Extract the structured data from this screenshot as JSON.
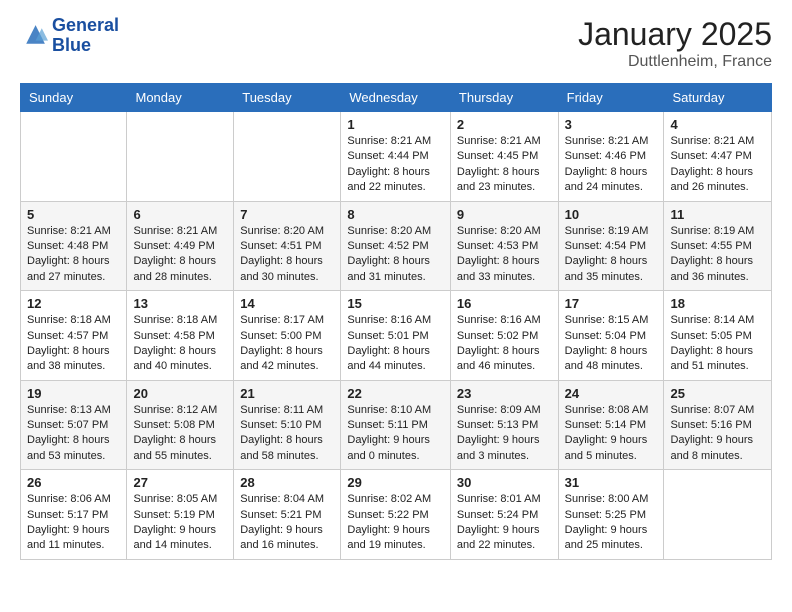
{
  "logo": {
    "line1": "General",
    "line2": "Blue"
  },
  "title": "January 2025",
  "location": "Duttlenheim, France",
  "weekdays": [
    "Sunday",
    "Monday",
    "Tuesday",
    "Wednesday",
    "Thursday",
    "Friday",
    "Saturday"
  ],
  "weeks": [
    [
      {
        "day": null
      },
      {
        "day": null
      },
      {
        "day": null
      },
      {
        "day": "1",
        "sunrise": "8:21 AM",
        "sunset": "4:44 PM",
        "daylight": "8 hours and 22 minutes."
      },
      {
        "day": "2",
        "sunrise": "8:21 AM",
        "sunset": "4:45 PM",
        "daylight": "8 hours and 23 minutes."
      },
      {
        "day": "3",
        "sunrise": "8:21 AM",
        "sunset": "4:46 PM",
        "daylight": "8 hours and 24 minutes."
      },
      {
        "day": "4",
        "sunrise": "8:21 AM",
        "sunset": "4:47 PM",
        "daylight": "8 hours and 26 minutes."
      }
    ],
    [
      {
        "day": "5",
        "sunrise": "8:21 AM",
        "sunset": "4:48 PM",
        "daylight": "8 hours and 27 minutes."
      },
      {
        "day": "6",
        "sunrise": "8:21 AM",
        "sunset": "4:49 PM",
        "daylight": "8 hours and 28 minutes."
      },
      {
        "day": "7",
        "sunrise": "8:20 AM",
        "sunset": "4:51 PM",
        "daylight": "8 hours and 30 minutes."
      },
      {
        "day": "8",
        "sunrise": "8:20 AM",
        "sunset": "4:52 PM",
        "daylight": "8 hours and 31 minutes."
      },
      {
        "day": "9",
        "sunrise": "8:20 AM",
        "sunset": "4:53 PM",
        "daylight": "8 hours and 33 minutes."
      },
      {
        "day": "10",
        "sunrise": "8:19 AM",
        "sunset": "4:54 PM",
        "daylight": "8 hours and 35 minutes."
      },
      {
        "day": "11",
        "sunrise": "8:19 AM",
        "sunset": "4:55 PM",
        "daylight": "8 hours and 36 minutes."
      }
    ],
    [
      {
        "day": "12",
        "sunrise": "8:18 AM",
        "sunset": "4:57 PM",
        "daylight": "8 hours and 38 minutes."
      },
      {
        "day": "13",
        "sunrise": "8:18 AM",
        "sunset": "4:58 PM",
        "daylight": "8 hours and 40 minutes."
      },
      {
        "day": "14",
        "sunrise": "8:17 AM",
        "sunset": "5:00 PM",
        "daylight": "8 hours and 42 minutes."
      },
      {
        "day": "15",
        "sunrise": "8:16 AM",
        "sunset": "5:01 PM",
        "daylight": "8 hours and 44 minutes."
      },
      {
        "day": "16",
        "sunrise": "8:16 AM",
        "sunset": "5:02 PM",
        "daylight": "8 hours and 46 minutes."
      },
      {
        "day": "17",
        "sunrise": "8:15 AM",
        "sunset": "5:04 PM",
        "daylight": "8 hours and 48 minutes."
      },
      {
        "day": "18",
        "sunrise": "8:14 AM",
        "sunset": "5:05 PM",
        "daylight": "8 hours and 51 minutes."
      }
    ],
    [
      {
        "day": "19",
        "sunrise": "8:13 AM",
        "sunset": "5:07 PM",
        "daylight": "8 hours and 53 minutes."
      },
      {
        "day": "20",
        "sunrise": "8:12 AM",
        "sunset": "5:08 PM",
        "daylight": "8 hours and 55 minutes."
      },
      {
        "day": "21",
        "sunrise": "8:11 AM",
        "sunset": "5:10 PM",
        "daylight": "8 hours and 58 minutes."
      },
      {
        "day": "22",
        "sunrise": "8:10 AM",
        "sunset": "5:11 PM",
        "daylight": "9 hours and 0 minutes."
      },
      {
        "day": "23",
        "sunrise": "8:09 AM",
        "sunset": "5:13 PM",
        "daylight": "9 hours and 3 minutes."
      },
      {
        "day": "24",
        "sunrise": "8:08 AM",
        "sunset": "5:14 PM",
        "daylight": "9 hours and 5 minutes."
      },
      {
        "day": "25",
        "sunrise": "8:07 AM",
        "sunset": "5:16 PM",
        "daylight": "9 hours and 8 minutes."
      }
    ],
    [
      {
        "day": "26",
        "sunrise": "8:06 AM",
        "sunset": "5:17 PM",
        "daylight": "9 hours and 11 minutes."
      },
      {
        "day": "27",
        "sunrise": "8:05 AM",
        "sunset": "5:19 PM",
        "daylight": "9 hours and 14 minutes."
      },
      {
        "day": "28",
        "sunrise": "8:04 AM",
        "sunset": "5:21 PM",
        "daylight": "9 hours and 16 minutes."
      },
      {
        "day": "29",
        "sunrise": "8:02 AM",
        "sunset": "5:22 PM",
        "daylight": "9 hours and 19 minutes."
      },
      {
        "day": "30",
        "sunrise": "8:01 AM",
        "sunset": "5:24 PM",
        "daylight": "9 hours and 22 minutes."
      },
      {
        "day": "31",
        "sunrise": "8:00 AM",
        "sunset": "5:25 PM",
        "daylight": "9 hours and 25 minutes."
      },
      {
        "day": null
      }
    ]
  ],
  "labels": {
    "sunrise": "Sunrise:",
    "sunset": "Sunset:",
    "daylight": "Daylight:"
  }
}
